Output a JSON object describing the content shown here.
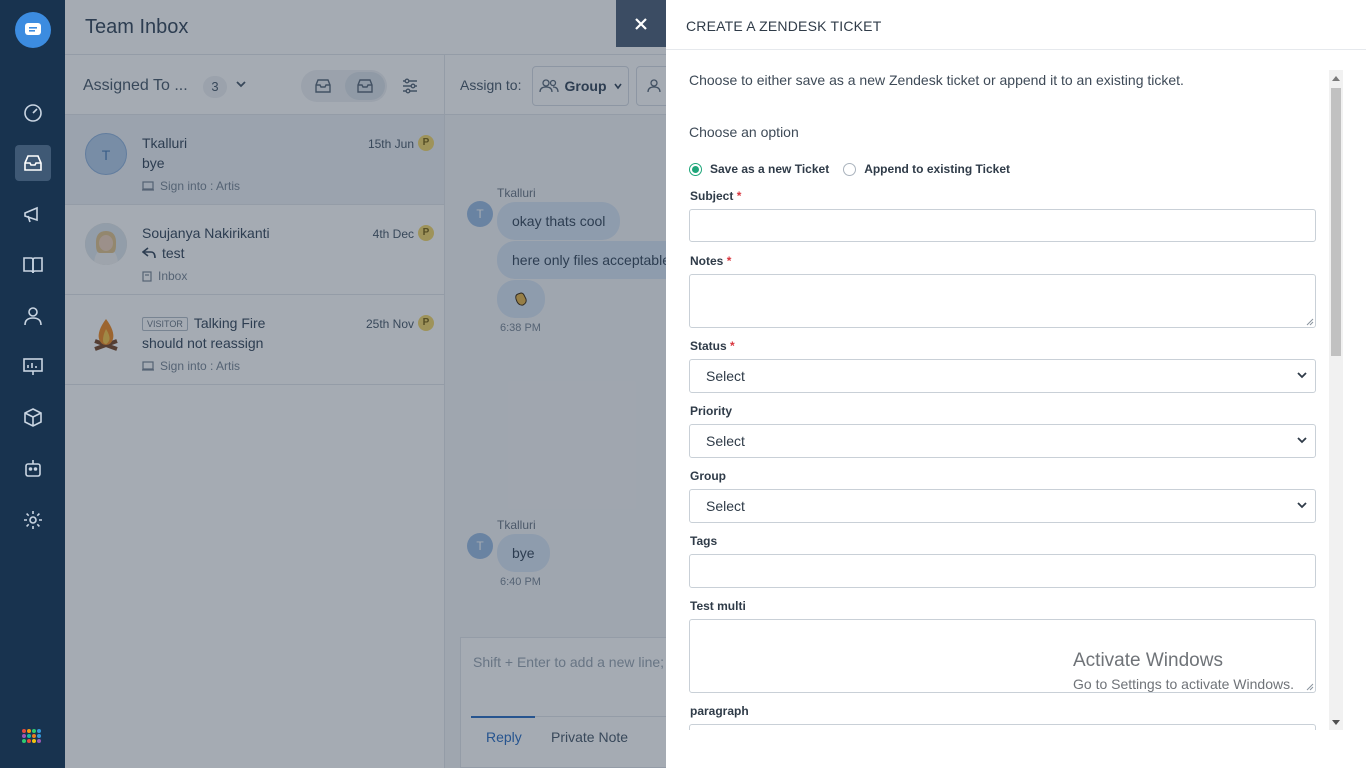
{
  "app": {
    "page_title": "Team Inbox"
  },
  "list_header": {
    "assigned_label": "Assigned To ...",
    "count": "3"
  },
  "conversations": [
    {
      "avatar_letter": "T",
      "name": "Tkalluri",
      "date": "15th Jun",
      "badge": "P",
      "message": "bye",
      "meta": "Sign into : Artis"
    },
    {
      "name": "Soujanya Nakirikanti",
      "date": "4th Dec",
      "badge": "P",
      "message": "test",
      "meta": "Inbox"
    },
    {
      "visitor_tag": "VISITOR",
      "name": "Talking Fire",
      "date": "25th Nov",
      "badge": "P",
      "message": "should not reassign",
      "meta": "Sign into : Artis"
    }
  ],
  "chat": {
    "assign_label": "Assign to:",
    "group_label": "Group",
    "messages": [
      {
        "sender": "Tkalluri",
        "text": "okay thats cool"
      },
      {
        "text": "here only files acceptable"
      },
      {
        "time": "6:38 PM"
      },
      {
        "sender": "Tkalluri",
        "text": "bye",
        "time": "6:40 PM"
      }
    ],
    "composer_placeholder": "Shift + Enter to add a new line;",
    "tabs": [
      "Reply",
      "Private Note"
    ]
  },
  "drawer": {
    "title": "CREATE A ZENDESK TICKET",
    "intro": "Choose to either save as a new Zendesk ticket or append it to an existing ticket.",
    "choose_label": "Choose an option",
    "radio_new": "Save as a new Ticket",
    "radio_append": "Append to existing Ticket",
    "fields": {
      "subject": "Subject",
      "notes": "Notes",
      "status": "Status",
      "priority": "Priority",
      "group": "Group",
      "tags": "Tags",
      "test_multi": "Test multi",
      "paragraph": "paragraph"
    },
    "required_mark": "*",
    "select_value": "Select"
  },
  "watermark": {
    "line1": "Activate Windows",
    "line2": "Go to Settings to activate Windows."
  },
  "colors": {
    "rail": "#18334f",
    "accent": "#2c6fc4",
    "radio_on": "#1fa67a"
  }
}
